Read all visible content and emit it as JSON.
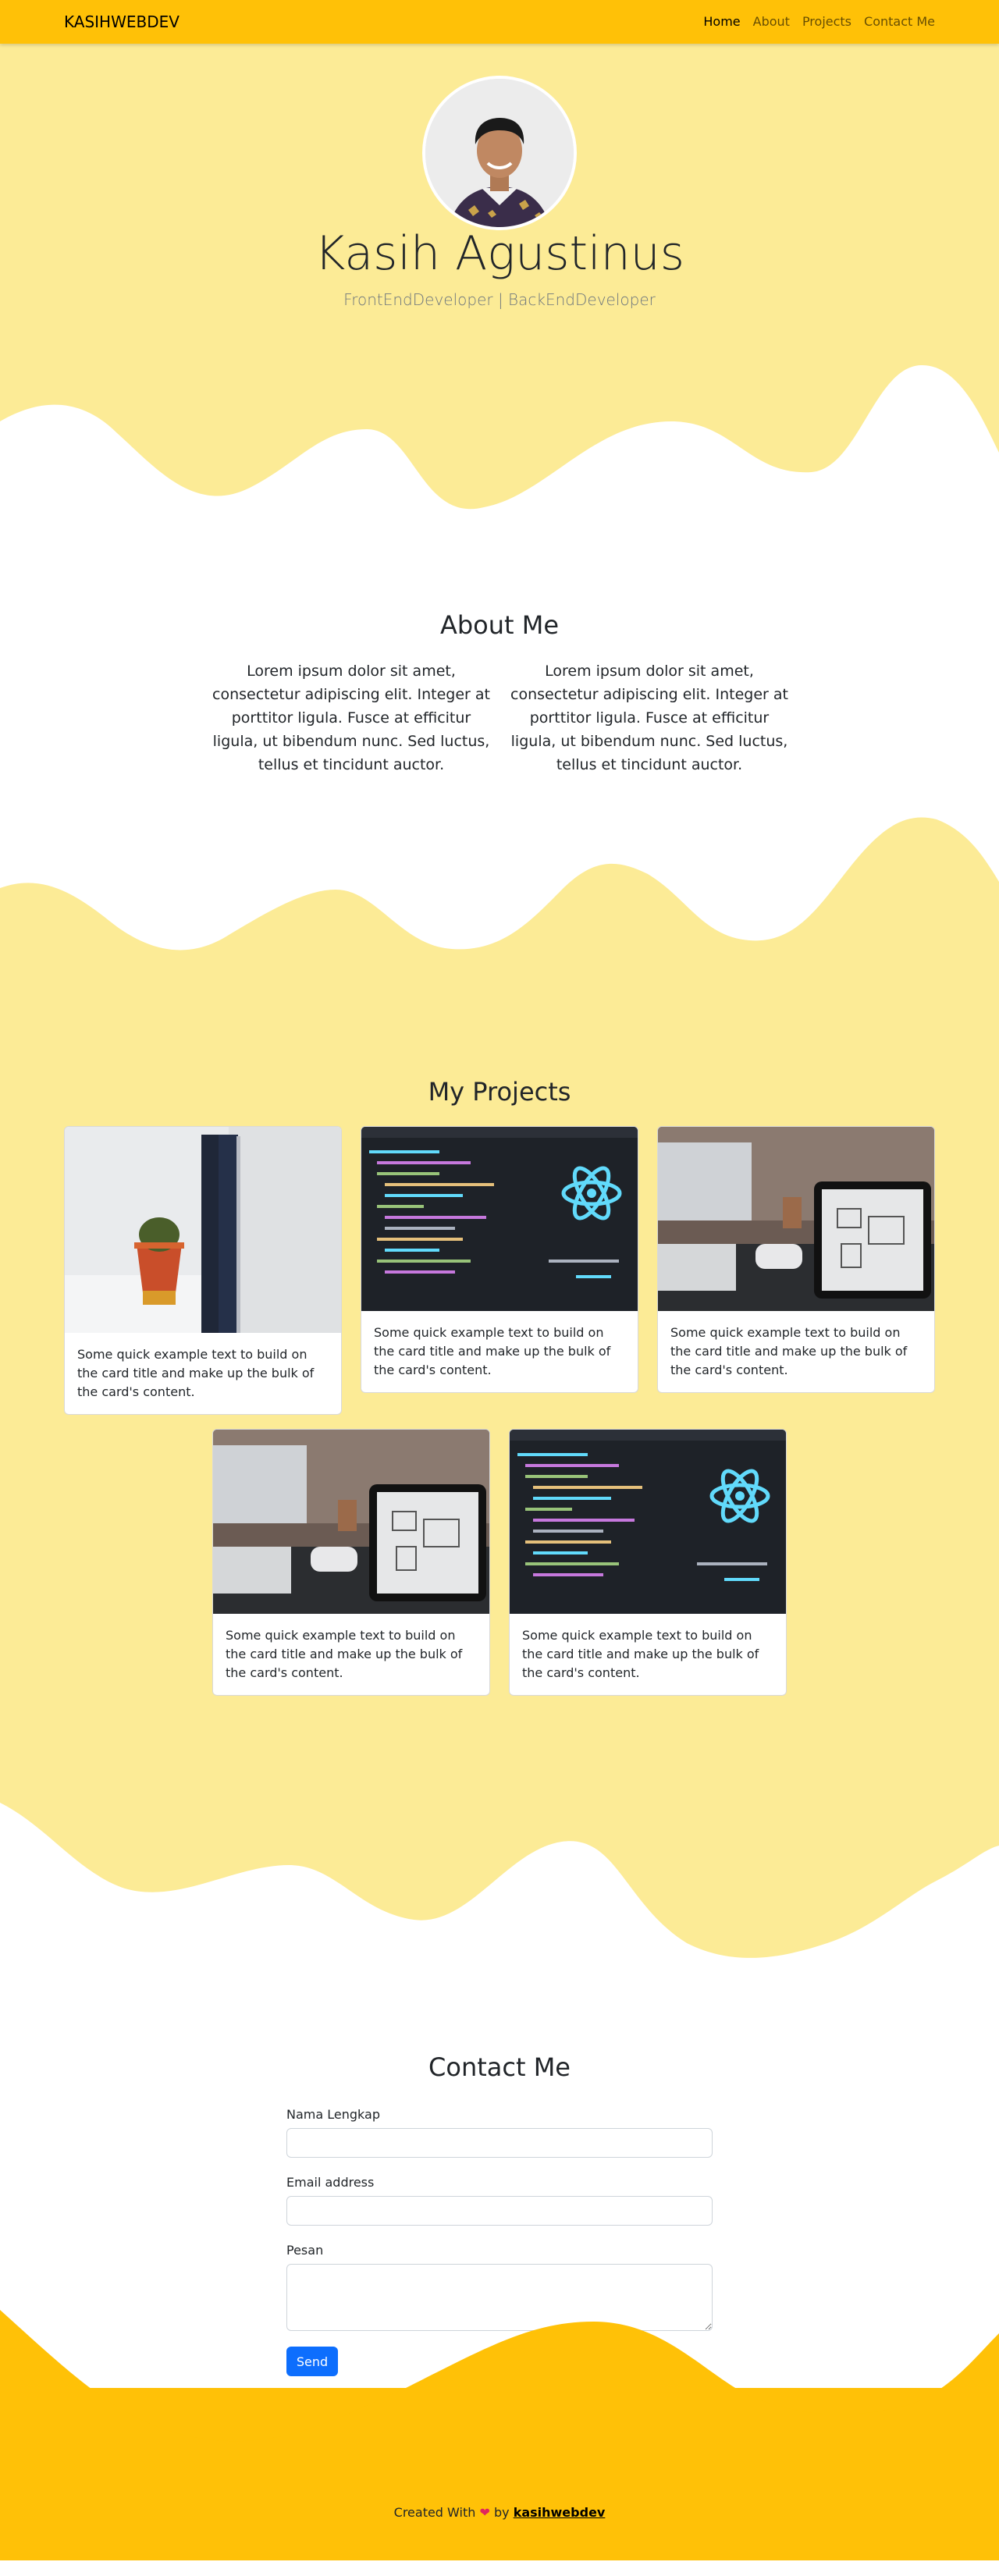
{
  "navbar": {
    "brand": "KASIHWEBDEV",
    "links": [
      "Home",
      "About",
      "Projects",
      "Contact Me"
    ]
  },
  "hero": {
    "name": "Kasih Agustinus",
    "tagline": "FrontEndDeveloper | BackEndDeveloper"
  },
  "about": {
    "title": "About Me",
    "col1": "Lorem ipsum dolor sit amet, consectetur adipiscing elit. Integer at porttitor ligula. Fusce at efficitur ligula, ut bibendum nunc. Sed luctus, tellus et tincidunt auctor.",
    "col2": "Lorem ipsum dolor sit amet, consectetur adipiscing elit. Integer at porttitor ligula. Fusce at efficitur ligula, ut bibendum nunc. Sed luctus, tellus et tincidunt auctor."
  },
  "projects": {
    "title": "My Projects",
    "card_text": "Some quick example text to build on the card title and make up the bulk of the card's content."
  },
  "contact": {
    "title": "Contact Me",
    "name_label": "Nama Lengkap",
    "email_label": "Email address",
    "message_label": "Pesan",
    "send_label": "Send"
  },
  "footer": {
    "prefix": "Created With",
    "by": "by",
    "author": "kasihwebdev"
  },
  "colors": {
    "accent": "#ffc107",
    "light_yellow": "#fceb96",
    "button": "#0d6efd"
  }
}
